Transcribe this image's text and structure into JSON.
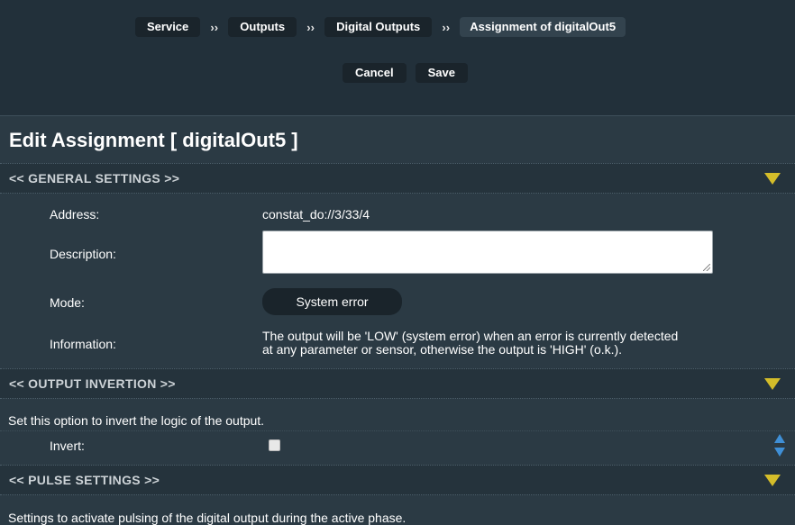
{
  "breadcrumb": {
    "items": [
      "Service",
      "Outputs",
      "Digital Outputs",
      "Assignment of digitalOut5"
    ],
    "separator": "››"
  },
  "toolbar": {
    "cancel_label": "Cancel",
    "save_label": "Save"
  },
  "page_title": "Edit Assignment [ digitalOut5 ]",
  "sections": {
    "general": {
      "title": "<<  GENERAL SETTINGS  >>"
    },
    "output_invertion": {
      "title": "<<  OUTPUT INVERTION  >>"
    },
    "pulse": {
      "title": "<<  PULSE SETTINGS  >>"
    }
  },
  "general": {
    "address_label": "Address:",
    "address_value": "constat_do://3/33/4",
    "description_label": "Description:",
    "description_value": "",
    "mode_label": "Mode:",
    "mode_value": "System error",
    "information_label": "Information:",
    "information_line1": "The output will be 'LOW' (system error) when an error is currently detected",
    "information_line2": "at any parameter or sensor, otherwise the output is 'HIGH' (o.k.)."
  },
  "invertion": {
    "note": "Set this option to invert the logic of the output.",
    "invert_label": "Invert:",
    "invert_checked": false
  },
  "pulse": {
    "note": "Settings to activate pulsing of the digital output during the active phase."
  },
  "icons": {
    "expand": "triangle-down-icon",
    "scroll": "up-down-arrows-icon"
  },
  "colors": {
    "background": "#2b3a44",
    "topbar": "#22303a",
    "accent_triangle": "#d4bd2a",
    "scroll_arrows": "#3f8fd6"
  }
}
